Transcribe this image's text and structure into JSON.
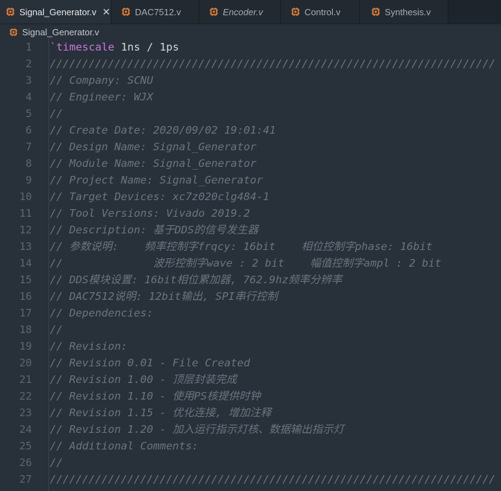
{
  "tabs": [
    {
      "label": "Signal_Generator.v",
      "active": true,
      "italic": false,
      "close": "✕"
    },
    {
      "label": "DAC7512.v",
      "active": false,
      "italic": false
    },
    {
      "label": "Encoder.v",
      "active": false,
      "italic": true
    },
    {
      "label": "Control.v",
      "active": false,
      "italic": false
    },
    {
      "label": "Synthesis.v",
      "active": false,
      "italic": false
    }
  ],
  "breadcrumb": {
    "file": "Signal_Generator.v"
  },
  "colors": {
    "icon": "#e8823a",
    "comment": "#6a7480",
    "keyword": "#c678dd"
  },
  "lines": [
    {
      "n": "1",
      "kw": "`timescale",
      "rest": " 1ns / 1ps"
    },
    {
      "n": "2",
      "cmt": "/////////////////////////////////////////////////////////////////////"
    },
    {
      "n": "3",
      "cmt": "// Company: SCNU"
    },
    {
      "n": "4",
      "cmt": "// Engineer: WJX"
    },
    {
      "n": "5",
      "cmt": "//"
    },
    {
      "n": "6",
      "cmt": "// Create Date: 2020/09/02 19:01:41"
    },
    {
      "n": "7",
      "cmt": "// Design Name: Signal_Generator"
    },
    {
      "n": "8",
      "cmt": "// Module Name: Signal_Generator"
    },
    {
      "n": "9",
      "cmt": "// Project Name: Signal_Generator"
    },
    {
      "n": "10",
      "cmt": "// Target Devices: xc7z020clg484-1"
    },
    {
      "n": "11",
      "cmt": "// Tool Versions: Vivado 2019.2"
    },
    {
      "n": "12",
      "cmt": "// Description: 基于DDS的信号发生器"
    },
    {
      "n": "13",
      "cmt": "// 参数说明:    频率控制字frqcy: 16bit    相位控制字phase: 16bit"
    },
    {
      "n": "14",
      "cmt": "//              波形控制字wave : 2 bit    幅值控制字ampl : 2 bit"
    },
    {
      "n": "15",
      "cmt": "// DDS模块设置: 16bit相位累加器, 762.9hz频率分辨率"
    },
    {
      "n": "16",
      "cmt": "// DAC7512说明: 12bit输出, SPI串行控制"
    },
    {
      "n": "17",
      "cmt": "// Dependencies:"
    },
    {
      "n": "18",
      "cmt": "//"
    },
    {
      "n": "19",
      "cmt": "// Revision:"
    },
    {
      "n": "20",
      "cmt": "// Revision 0.01 - File Created"
    },
    {
      "n": "21",
      "cmt": "// Revision 1.00 - 顶层封装完成"
    },
    {
      "n": "22",
      "cmt": "// Revision 1.10 - 使用PS核提供时钟"
    },
    {
      "n": "23",
      "cmt": "// Revision 1.15 - 优化连接, 增加注释"
    },
    {
      "n": "24",
      "cmt": "// Revision 1.20 - 加入运行指示灯核、数据输出指示灯"
    },
    {
      "n": "25",
      "cmt": "// Additional Comments:"
    },
    {
      "n": "26",
      "cmt": "//"
    },
    {
      "n": "27",
      "cmt": "/////////////////////////////////////////////////////////////////////"
    }
  ]
}
